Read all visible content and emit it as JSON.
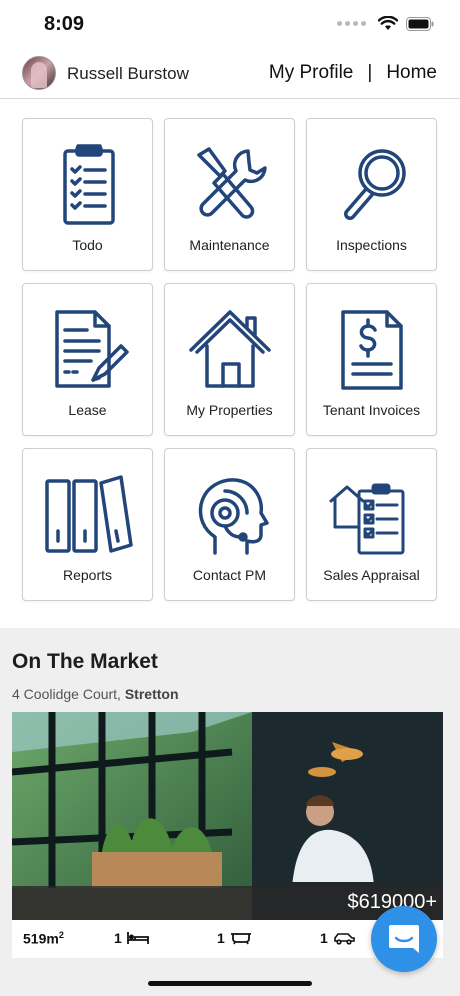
{
  "status_bar": {
    "time": "8:09"
  },
  "header": {
    "user_name": "Russell Burstow",
    "nav": {
      "profile": "My Profile",
      "separator": "|",
      "home": "Home"
    }
  },
  "tiles": [
    {
      "label": "Todo",
      "icon": "clipboard-checklist-icon"
    },
    {
      "label": "Maintenance",
      "icon": "wrench-screwdriver-icon"
    },
    {
      "label": "Inspections",
      "icon": "magnifier-icon"
    },
    {
      "label": "Lease",
      "icon": "document-pen-icon"
    },
    {
      "label": "My Properties",
      "icon": "house-icon"
    },
    {
      "label": "Tenant Invoices",
      "icon": "invoice-dollar-icon"
    },
    {
      "label": "Reports",
      "icon": "binders-icon"
    },
    {
      "label": "Contact PM",
      "icon": "headset-head-icon"
    },
    {
      "label": "Sales Appraisal",
      "icon": "house-clipboard-icon"
    }
  ],
  "market": {
    "title": "On The Market",
    "address": "4 Coolidge Court, ",
    "suburb": "Stretton",
    "price": "$619000+",
    "features": {
      "area": "519m",
      "area_unit_sup": "2",
      "beds": "1",
      "baths": "1",
      "cars": "1"
    }
  },
  "colors": {
    "icon_navy": "#23467a",
    "fab_blue": "#2f90e8",
    "market_bg": "#efefef"
  }
}
